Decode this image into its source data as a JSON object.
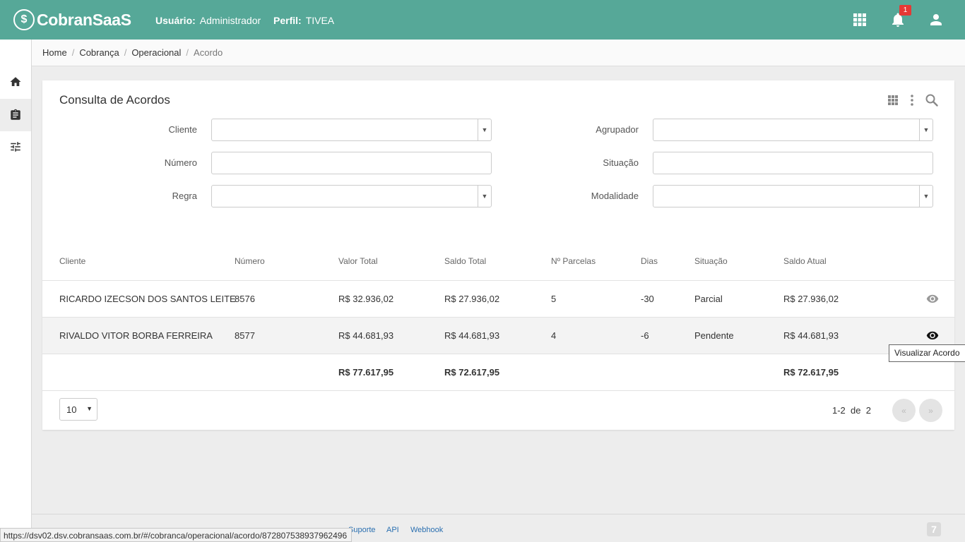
{
  "header": {
    "logo_text": "CobranSaaS",
    "user_label": "Usuário:",
    "user_value": "Administrador",
    "profile_label": "Perfil:",
    "profile_value": "TIVEA",
    "notification_count": "1",
    "icons": [
      "apps-grid-icon",
      "bell-icon",
      "user-icon"
    ]
  },
  "sidebar": {
    "items": [
      {
        "icon": "home-icon",
        "active": false
      },
      {
        "icon": "clipboard-icon",
        "active": true
      },
      {
        "icon": "sliders-icon",
        "active": false
      }
    ]
  },
  "breadcrumb": [
    "Home",
    "Cobrança",
    "Operacional",
    "Acordo"
  ],
  "panel": {
    "title": "Consulta de Acordos",
    "filters": {
      "cliente": {
        "label": "Cliente",
        "value": ""
      },
      "agrupador": {
        "label": "Agrupador",
        "value": ""
      },
      "numero": {
        "label": "Número",
        "value": ""
      },
      "situacao": {
        "label": "Situação",
        "value": ""
      },
      "regra": {
        "label": "Regra",
        "value": ""
      },
      "modalidade": {
        "label": "Modalidade",
        "value": ""
      }
    },
    "table": {
      "columns": [
        "Cliente",
        "Número",
        "Valor Total",
        "Saldo Total",
        "Nº Parcelas",
        "Dias",
        "Situação",
        "Saldo Atual"
      ],
      "rows": [
        [
          "RICARDO IZECSON DOS SANTOS LEITE",
          "8576",
          "R$ 32.936,02",
          "R$ 27.936,02",
          "5",
          "-30",
          "Parcial",
          "R$ 27.936,02"
        ],
        [
          "RIVALDO VITOR BORBA FERREIRA",
          "8577",
          "R$ 44.681,93",
          "R$ 44.681,93",
          "4",
          "-6",
          "Pendente",
          "R$ 44.681,93"
        ]
      ],
      "totals": {
        "valor_total": "R$ 77.617,95",
        "saldo_total": "R$ 72.617,95",
        "saldo_atual": "R$ 72.617,95"
      }
    },
    "pagination": {
      "page_size": "10",
      "range": "1-2",
      "of_label": "de",
      "total": "2",
      "prev": "«",
      "next": "»"
    },
    "tooltip": "Visualizar Acordo"
  },
  "footer": {
    "links": [
      "Suporte",
      "API",
      "Webhook"
    ],
    "status_url": "https://dsv02.dsv.cobransaas.com.br/#/cobranca/operacional/acordo/872807538937962496",
    "corner_logo": "7"
  },
  "colors": {
    "header": "#56a898",
    "link": "#2a6fb0",
    "badge": "#e53935"
  }
}
